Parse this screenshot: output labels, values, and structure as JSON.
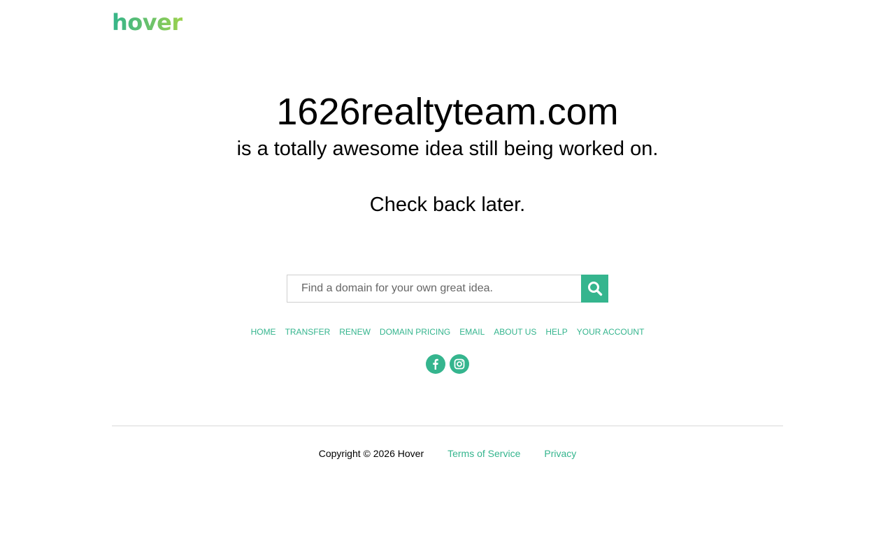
{
  "brand": {
    "logo_text": "hover",
    "accent_color": "#35b58e"
  },
  "main": {
    "domain": "1626realtyteam.com",
    "tagline": "is a totally awesome idea still being worked on.",
    "message": "Check back later."
  },
  "search": {
    "placeholder": "Find a domain for your own great idea.",
    "value": "",
    "button_icon": "search-icon"
  },
  "nav": {
    "items": [
      {
        "label": "HOME"
      },
      {
        "label": "TRANSFER"
      },
      {
        "label": "RENEW"
      },
      {
        "label": "DOMAIN PRICING"
      },
      {
        "label": "EMAIL"
      },
      {
        "label": "ABOUT US"
      },
      {
        "label": "HELP"
      },
      {
        "label": "YOUR ACCOUNT"
      }
    ]
  },
  "social": {
    "items": [
      {
        "icon": "facebook-icon"
      },
      {
        "icon": "instagram-icon"
      }
    ]
  },
  "footer": {
    "copyright": "Copyright © 2026 Hover",
    "terms_label": "Terms of Service",
    "privacy_label": "Privacy"
  }
}
